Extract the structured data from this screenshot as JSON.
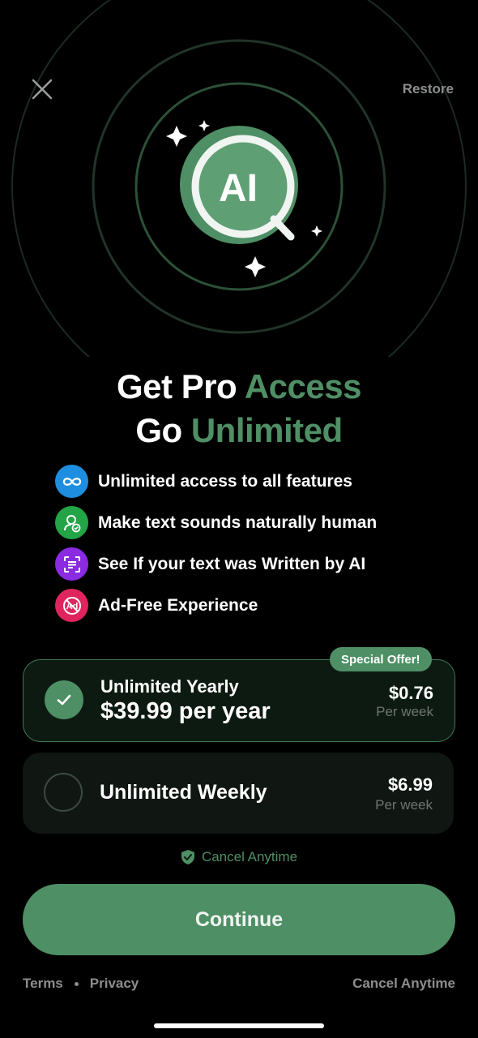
{
  "header": {
    "restore_label": "Restore"
  },
  "hero": {
    "badge_text": "AI"
  },
  "headline": {
    "line1_prefix": "Get Pro",
    "line1_accent": "Access",
    "line2_prefix": "Go",
    "line2_accent": "Unlimited"
  },
  "features": [
    {
      "label": "Unlimited access to all features",
      "icon": "infinity-icon",
      "color": "#1e8fe0"
    },
    {
      "label": "Make text sounds naturally human",
      "icon": "user-check-icon",
      "color": "#22a447"
    },
    {
      "label": "See If your text was Written by AI",
      "icon": "scan-text-icon",
      "color": "#8a2be2"
    },
    {
      "label": "Ad-Free Experience",
      "icon": "no-ads-icon",
      "color": "#e0245e"
    }
  ],
  "plans": {
    "badge": "Special Offer!",
    "yearly": {
      "title": "Unlimited Yearly",
      "subtitle": "$39.99 per year",
      "price": "$0.76",
      "unit": "Per week",
      "selected": true
    },
    "weekly": {
      "title": "Unlimited Weekly",
      "price": "$6.99",
      "unit": "Per week",
      "selected": false
    }
  },
  "cancel_note": "Cancel Anytime",
  "continue_label": "Continue",
  "footer": {
    "terms": "Terms",
    "privacy": "Privacy",
    "cancel": "Cancel Anytime"
  },
  "colors": {
    "accent": "#4f8f65",
    "background": "#000000"
  }
}
